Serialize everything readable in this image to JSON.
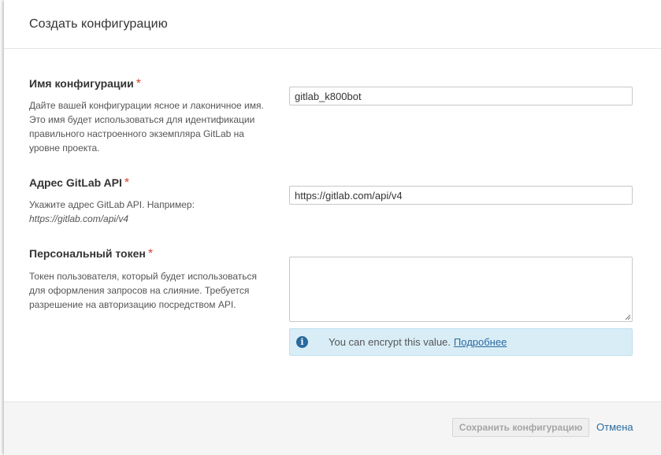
{
  "dialog": {
    "title": "Создать конфигурацию"
  },
  "fields": {
    "config_name": {
      "label": "Имя конфигурации",
      "required_mark": "*",
      "description": "Дайте вашей конфигурации ясное и лаконичное имя. Это имя будет использоваться для идентификации правильного настроенного экземпляра GitLab на уровне проекта.",
      "value": "gitlab_k800bot"
    },
    "api_url": {
      "label": "Адрес GitLab API",
      "required_mark": "*",
      "description": "Укажите адрес GitLab API. Например:",
      "example": "https://gitlab.com/api/v4",
      "value": "https://gitlab.com/api/v4"
    },
    "token": {
      "label": "Персональный токен",
      "required_mark": "*",
      "description": "Токен пользователя, который будет использоваться для оформления запросов на слияние. Требуется разрешение на авторизацию посредством API.",
      "value": ""
    }
  },
  "info": {
    "icon": "info-icon",
    "text": "You can encrypt this value.",
    "link": "Подробнее"
  },
  "footer": {
    "save_label": "Сохранить конфигурацию",
    "cancel_label": "Отмена"
  },
  "colors": {
    "required": "#d04437",
    "info_bg": "#d9edf7",
    "link": "#2a6a9e"
  }
}
